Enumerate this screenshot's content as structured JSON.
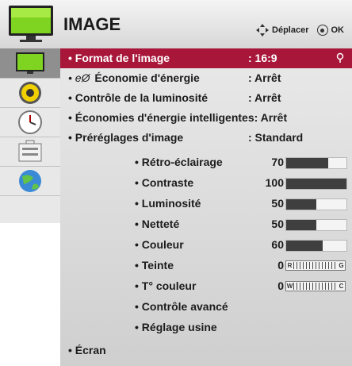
{
  "header": {
    "title": "IMAGE",
    "hint_move": "Déplacer",
    "hint_ok": "OK",
    "icon": "tv-screen-icon"
  },
  "sidebar": {
    "items": [
      {
        "name": "picture",
        "icon": "tv-screen-icon",
        "active": true
      },
      {
        "name": "audio",
        "icon": "speaker-icon",
        "active": false
      },
      {
        "name": "time",
        "icon": "clock-icon",
        "active": false
      },
      {
        "name": "options",
        "icon": "toolbox-icon",
        "active": false
      },
      {
        "name": "network",
        "icon": "globe-icon",
        "active": false
      }
    ]
  },
  "menu": {
    "items": [
      {
        "label": "• Format de l'image",
        "value": ": 16:9",
        "selected": true
      },
      {
        "label": "Économie d'énergie",
        "prefix": "• eØ ",
        "value": ": Arrêt"
      },
      {
        "label": "• Contrôle de la luminosité",
        "value": ": Arrêt"
      },
      {
        "label": "• Économies d'énergie intelligentes: Arrêt",
        "value": ""
      },
      {
        "label": "• Préréglages d'image",
        "value": ": Standard"
      }
    ],
    "sub_items": [
      {
        "label": "• Rétro-éclairage",
        "value": "70",
        "level": 0.7
      },
      {
        "label": "• Contraste",
        "value": "100",
        "level": 1.0
      },
      {
        "label": "• Luminosité",
        "value": "50",
        "level": 0.5
      },
      {
        "label": "• Netteté",
        "value": "50",
        "level": 0.5
      },
      {
        "label": "• Couleur",
        "value": "60",
        "level": 0.6
      },
      {
        "label": "• Teinte",
        "value": "0",
        "balance_left": "R",
        "balance_right": "G"
      },
      {
        "label": "• T° couleur",
        "value": "0",
        "balance_left": "W",
        "balance_right": "C"
      },
      {
        "label": "• Contrôle avancé",
        "value": ""
      },
      {
        "label": "• Réglage usine",
        "value": ""
      }
    ],
    "footer_item": "• Écran"
  },
  "colors": {
    "selected": "#a8173a",
    "bar_fill": "#3f3f3f"
  }
}
